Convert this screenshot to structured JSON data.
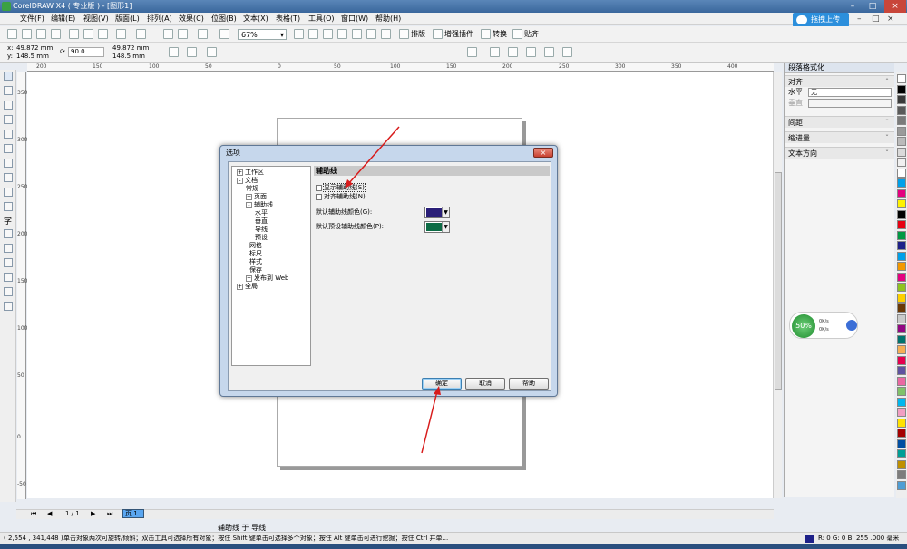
{
  "window": {
    "title": "CorelDRAW X4 ( 专业版 ) - [图形1]"
  },
  "menu": [
    "文件(F)",
    "编辑(E)",
    "视图(V)",
    "版面(L)",
    "排列(A)",
    "效果(C)",
    "位图(B)",
    "文本(X)",
    "表格(T)",
    "工具(O)",
    "窗口(W)",
    "帮助(H)"
  ],
  "cloud_button": "拖拽上传",
  "toolbar": {
    "zoom": "67%",
    "typeset": "排版",
    "enhance": "增强插件",
    "convert": "转换",
    "snap": "贴齐"
  },
  "propbar": {
    "x": "49.872 mm",
    "y": "148.5 mm",
    "angle": "90.0",
    "x2": "49.872 mm",
    "y2": "148.5 mm"
  },
  "rulers": {
    "top": [
      "200",
      "150",
      "100",
      "50",
      "0",
      "50",
      "100",
      "150",
      "200",
      "250",
      "300",
      "350",
      "400"
    ],
    "left": [
      "350",
      "300",
      "250",
      "200",
      "150",
      "100",
      "50",
      "0",
      "-50"
    ]
  },
  "docker": {
    "title": "段落格式化",
    "align_section": "对齐",
    "horizontal_label": "水平",
    "horizontal_value": "无",
    "vertical_label": "垂直",
    "spacing": "间距",
    "indent": "缩进量",
    "text_direction": "文本方向"
  },
  "netwidget": {
    "percent": "50%",
    "up": "0K/s",
    "down": "0K/s"
  },
  "pagebar": {
    "position": "1 / 1",
    "tab": "页 1"
  },
  "guide_label": "辅助线 于 导线",
  "statusbar": {
    "coords": "( 2,554 , 341,448 )",
    "hint": "单击对象两次可旋转/倾斜；双击工具可选择所有对象；按住 Shift 键单击可选择多个对象；按住 Alt 键单击可进行挖掘；按住 Ctrl 并单...",
    "color": "R: 0 G: 0 B: 255 .000 毫米"
  },
  "dialog": {
    "title": "选项",
    "tree": [
      {
        "label": "工作区",
        "pm": "+"
      },
      {
        "label": "文档",
        "pm": "-"
      },
      {
        "label": "常规",
        "pm": ""
      },
      {
        "label": "页面",
        "pm": "+"
      },
      {
        "label": "辅助线",
        "pm": "-"
      },
      {
        "label": "水平",
        "pm": ""
      },
      {
        "label": "垂直",
        "pm": ""
      },
      {
        "label": "导线",
        "pm": ""
      },
      {
        "label": "预设",
        "pm": ""
      },
      {
        "label": "网格",
        "pm": ""
      },
      {
        "label": "标尺",
        "pm": ""
      },
      {
        "label": "样式",
        "pm": ""
      },
      {
        "label": "保存",
        "pm": ""
      },
      {
        "label": "发布到 Web",
        "pm": "+"
      },
      {
        "label": "全局",
        "pm": "+"
      }
    ],
    "pane_title": "辅助线",
    "show_guides": "显示辅助线(S)",
    "snap_guides": "对齐辅助线(N)",
    "default_color_label": "默认辅助线颜色(G):",
    "preset_color_label": "默认预设辅助线颜色(P):",
    "default_color": "#2a1f78",
    "preset_color": "#0c6b45",
    "ok": "确定",
    "cancel": "取消",
    "help": "帮助"
  },
  "colors": {
    "palette": [
      "#ffffff",
      "#000000",
      "#3a3a3a",
      "#5a5a5a",
      "#7a7a7a",
      "#9a9a9a",
      "#bababa",
      "#dadada",
      "#f0f0f0",
      "#ffffff",
      "#00a0e9",
      "#e4007f",
      "#fff100",
      "#000000",
      "#e60012",
      "#009944",
      "#1d2088",
      "#00a0e9",
      "#f39800",
      "#e4007f",
      "#8fc31f",
      "#fdd000",
      "#6a3906",
      "#c9caca",
      "#920783",
      "#00736d",
      "#f6ae54",
      "#e5004f",
      "#5f52a0",
      "#ea68a2",
      "#80c269",
      "#00b7ee",
      "#f19ec2",
      "#ffe100",
      "#a40000",
      "#004ea2",
      "#009e96",
      "#bf9000",
      "#7d7d7d",
      "#4e9dd4"
    ]
  }
}
